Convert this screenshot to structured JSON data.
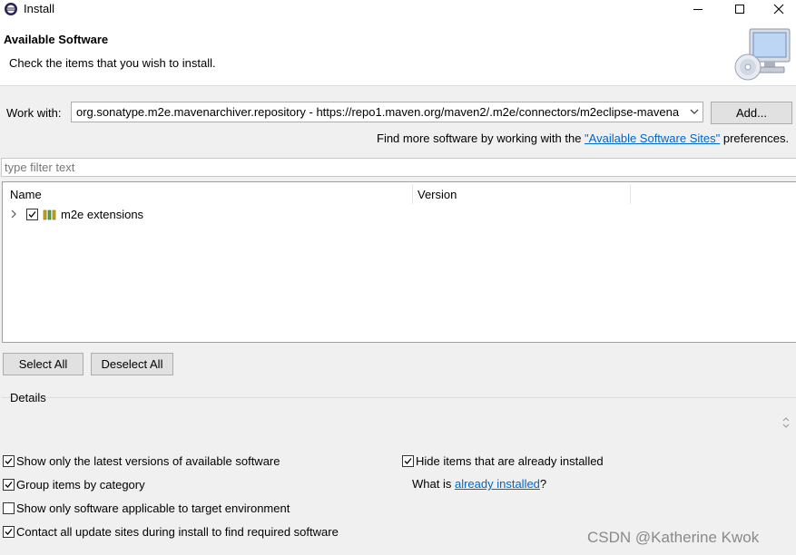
{
  "window": {
    "title": "Install",
    "minimize_icon": "minimize-icon",
    "maximize_icon": "maximize-icon",
    "close_icon": "close-icon"
  },
  "header": {
    "heading": "Available Software",
    "subheading": "Check the items that you wish to install."
  },
  "work_with": {
    "label": "Work with:",
    "value": "org.sonatype.m2e.mavenarchiver.repository - https://repo1.maven.org/maven2/.m2e/connectors/m2eclipse-mavena",
    "add_label": "Add..."
  },
  "find_more": {
    "prefix": "Find more software by working with the ",
    "link": "\"Available Software Sites\"",
    "suffix": " preferences."
  },
  "filter": {
    "placeholder": "type filter text"
  },
  "tree": {
    "columns": [
      "Name",
      "Version"
    ],
    "rows": [
      {
        "label": "m2e extensions",
        "checked": true,
        "icon": "category-icon"
      }
    ]
  },
  "buttons": {
    "select_all": "Select All",
    "deselect_all": "Deselect All"
  },
  "details": {
    "label": "Details"
  },
  "options": {
    "latest_versions": {
      "label": "Show only the latest versions of available software",
      "checked": true
    },
    "group_by_category": {
      "label": "Group items by category",
      "checked": true
    },
    "applicable_only": {
      "label": "Show only software applicable to target environment",
      "checked": false
    },
    "contact_all": {
      "label": "Contact all update sites during install to find required software",
      "checked": true
    },
    "hide_installed": {
      "label": "Hide items that are already installed",
      "checked": true
    }
  },
  "what_is": {
    "prefix": "What is ",
    "link": "already installed",
    "suffix": "?"
  },
  "watermark": "CSDN @Katherine Kwok",
  "colors": {
    "link": "#0066cc",
    "background": "#f0f0f0",
    "button": "#e1e1e1"
  }
}
